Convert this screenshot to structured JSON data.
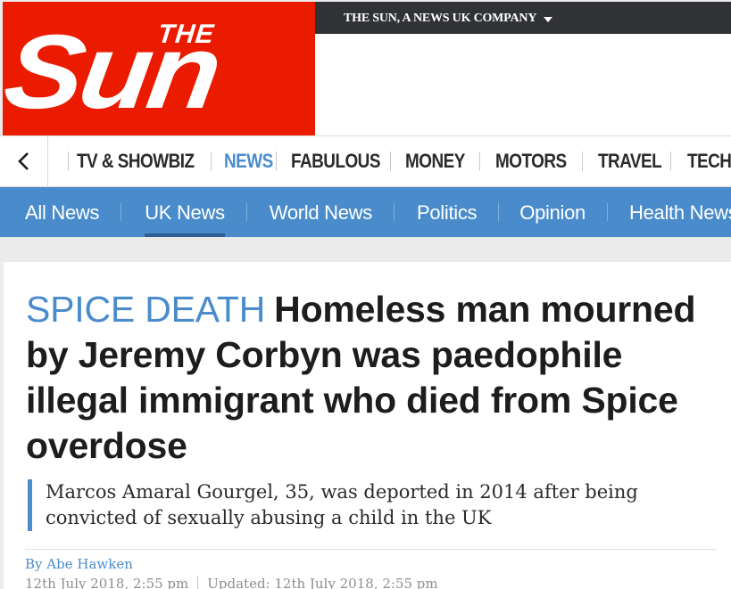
{
  "brand": {
    "logo_the": "THE",
    "logo_sun": "Sun",
    "network_label": "THE SUN, A NEWS UK COMPANY",
    "accent_red": "#eb1b00",
    "accent_blue": "#4a8ccb"
  },
  "main_nav": {
    "back_icon": "chevron-left-icon",
    "items": [
      {
        "label": "TV & SHOWBIZ",
        "active": false
      },
      {
        "label": "NEWS",
        "active": true
      },
      {
        "label": "FABULOUS",
        "active": false
      },
      {
        "label": "MONEY",
        "active": false
      },
      {
        "label": "MOTORS",
        "active": false
      },
      {
        "label": "TRAVEL",
        "active": false
      },
      {
        "label": "TECH",
        "active": false
      }
    ]
  },
  "sub_nav": {
    "items": [
      {
        "label": "All News",
        "active": false
      },
      {
        "label": "UK News",
        "active": true
      },
      {
        "label": "World News",
        "active": false
      },
      {
        "label": "Politics",
        "active": false
      },
      {
        "label": "Opinion",
        "active": false
      },
      {
        "label": "Health News",
        "active": false
      }
    ]
  },
  "article": {
    "kicker": "SPICE DEATH",
    "headline": "Homeless man mourned by Jeremy Corbyn was paedophile illegal immigrant who died from Spice overdose",
    "standfirst": "Marcos Amaral Gourgel, 35, was deported in 2014 after being convicted of sexually abusing a child in the UK",
    "byline_prefix": "By",
    "author": "Abe Hawken",
    "published": "12th July 2018, 2:55 pm",
    "updated": "Updated: 12th July 2018, 2:55 pm"
  }
}
